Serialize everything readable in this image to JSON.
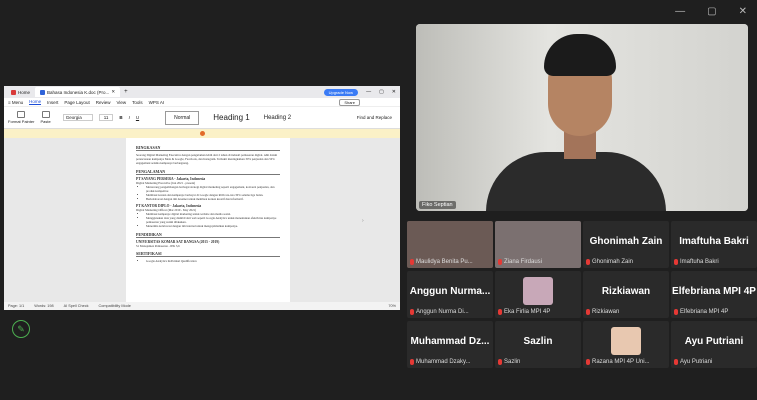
{
  "window_controls": [
    "—",
    "▢",
    "✕"
  ],
  "shared": {
    "tabs": [
      {
        "label": "Home",
        "color": "#d93a3a"
      },
      {
        "label": "Bahasa Indonesia K.doc (Pro...",
        "color": "#2f63d9"
      }
    ],
    "upgrade": "Upgrade Now",
    "menu": [
      "≡ Menu",
      "Home",
      "Insert",
      "Page Layout",
      "Review",
      "View",
      "Tools",
      "WPS AI"
    ],
    "share": "Share",
    "ribbon": {
      "tools": [
        "Format Painter",
        "Paste"
      ],
      "font": "Georgia",
      "size": "11",
      "styles": [
        "Normal",
        "Heading 1",
        "Heading 2"
      ],
      "find": "Find and Replace"
    },
    "doc": {
      "h_ringkasan": "RINGKASAN",
      "p_ringkasan": "Seorang Digital Marketing Executive dengan pengalaman lebih dari 2 tahun di industri pemasaran digital. Ahli dalam perencanaan kampanye Meta & Google, Facebook, dan Instagram. Terbukti meningkatkan 30% penjualan dan 50% engagement selama kampanye berlangsung.",
      "h_pengalaman": "PENGALAMAN",
      "job1": "PT SAYANG PERSERA - Jakarta, Indonesia",
      "job1_role": "Digital Marketing Executive (Jun 2021 - present)",
      "job1_items": [
        "Merancang pengembangan berbagai strategi digital marketing seperti engagement, konversi penjualan, dan produk kompetitor.",
        "Membuat konten dan kampanye berbayar di Google dengan ROI rata-rata 30% selama tiga bulan.",
        "Berkolaborasi dengan tim desainer untuk membuat konten kreatif dan informatif."
      ],
      "job2": "PT KANTOR DIPLO - Jakarta, Indonesia",
      "job2_role": "Digital Marketing Officer (Mar 2019 - May 2021)",
      "job2_items": [
        "Membuat kampanye digital marketing untuk website dan media sosial.",
        "Menggunakan data yang diambil dari web seperti Google Analytics untuk menentukan efektivitas kampanye pemasaran yang sudah dilakukan.",
        "Menerima kolaborasi dengan tim internal untuk mengoptimalkan kampanye."
      ],
      "h_pendidikan": "PENDIDIKAN",
      "edu": "UNIVERSITAS KOMAR SAT BANGSA (2015 - 2019)",
      "edu_detail": "S1 Manajemen Pemasaran - IPK 3,6",
      "h_sertifikasi": "SERTIFIKASI",
      "cert": "Google Analytics Individual Qualification"
    },
    "status": {
      "page": "Page: 1/1",
      "words": "Words: 198",
      "spell": "AI Spell Check",
      "mode": "Compatibility Mode",
      "zoom": "70%"
    }
  },
  "speaker": {
    "name": "Fiko Septian"
  },
  "participants": [
    {
      "big": "",
      "name": "Maulidya Benita Pu...",
      "video": true,
      "bg": "#6b5a55"
    },
    {
      "big": "",
      "name": "Ziana Firdausi",
      "video": true,
      "bg": "#7b7070"
    },
    {
      "big": "Ghonimah Zain",
      "name": "Ghonimah Zain",
      "video": false
    },
    {
      "big": "Imaftuha Bakri",
      "name": "Imaftuha Bakri",
      "video": false
    },
    {
      "big": "Anggun Nurma...",
      "name": "Anggun Nurma Di...",
      "video": false
    },
    {
      "big": "",
      "name": "Eka Firlia MPI 4P",
      "video": false,
      "thumb": "#c8a8b8"
    },
    {
      "big": "Rizkiawan",
      "name": "Rizkiawan",
      "video": false
    },
    {
      "big": "Elfebriana MPI 4P",
      "name": "Elfebriana MPI 4P",
      "video": false
    },
    {
      "big": "Muhammad Dz...",
      "name": "Muhammad Dzaky...",
      "video": false
    },
    {
      "big": "Sazlin",
      "name": "Sazlin",
      "video": false
    },
    {
      "big": "",
      "name": "Razana MPI 4P Uni...",
      "video": false,
      "thumb": "#e8c8b0"
    },
    {
      "big": "Ayu Putriani",
      "name": "Ayu Putriani",
      "video": false
    }
  ]
}
